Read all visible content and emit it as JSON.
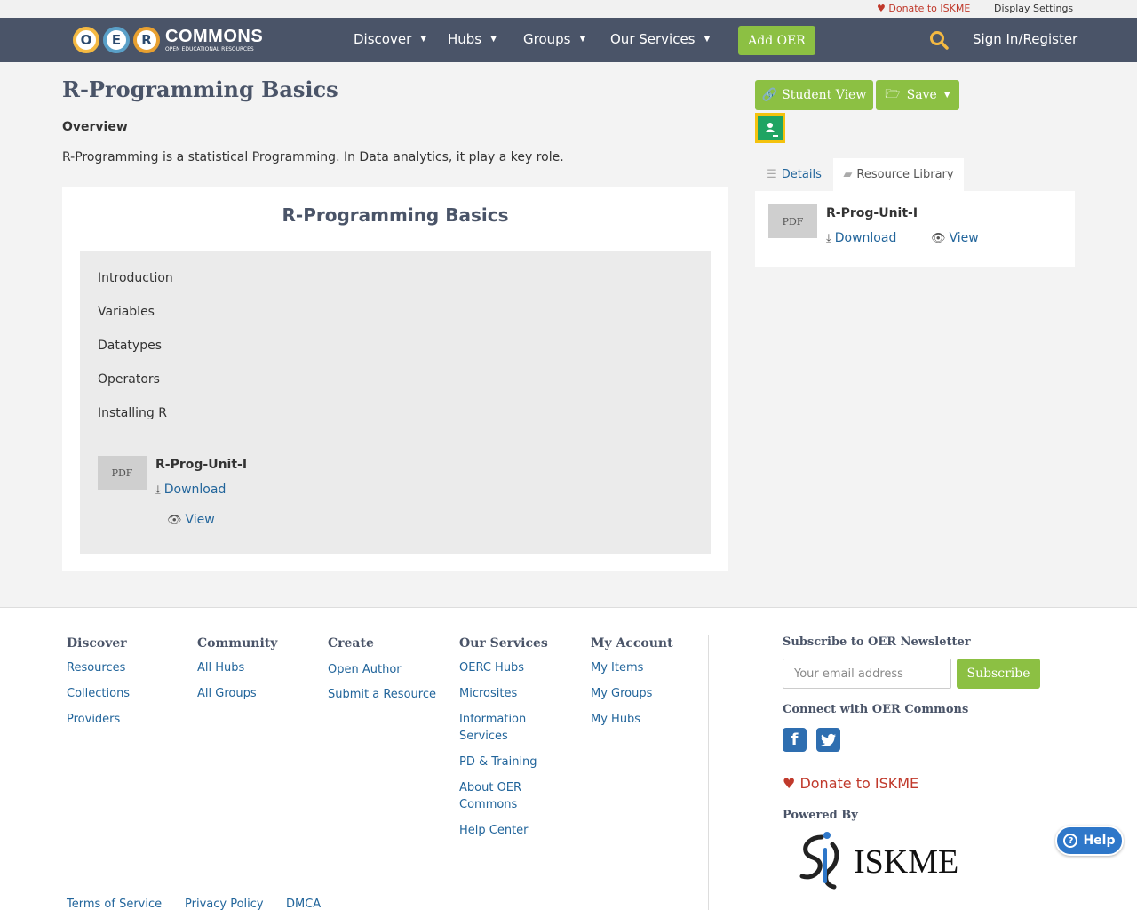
{
  "utility": {
    "donate": "Donate to ISKME",
    "display_settings": "Display Settings"
  },
  "nav": {
    "logo_letters": [
      "O",
      "E",
      "R"
    ],
    "logo_word": "COMMONS",
    "logo_tagline": "OPEN EDUCATIONAL RESOURCES",
    "items": [
      "Discover",
      "Hubs",
      "Groups",
      "Our Services"
    ],
    "add_oer": "Add OER",
    "sign_in": "Sign In/Register"
  },
  "page": {
    "title": "R-Programming Basics",
    "overview_label": "Overview",
    "overview_text": "R-Programming is a statistical Programming. In Data analytics, it play a key role."
  },
  "card": {
    "title": "R-Programming Basics",
    "topics": [
      "Introduction",
      "Variables",
      "Datatypes",
      "Operators",
      "Installing R"
    ],
    "file": {
      "type": "PDF",
      "name": "R-Prog-Unit-I",
      "download": "Download",
      "view": "View"
    }
  },
  "sidebar": {
    "student_view": "Student View",
    "save": "Save",
    "tabs": {
      "details": "Details",
      "library": "Resource Library"
    },
    "file": {
      "type": "PDF",
      "name": "R-Prog-Unit-I",
      "download": "Download",
      "view": "View"
    }
  },
  "footer": {
    "columns": [
      {
        "head": "Discover",
        "links": [
          "Resources",
          "Collections",
          "Providers"
        ]
      },
      {
        "head": "Community",
        "links": [
          "All Hubs",
          "All Groups"
        ]
      },
      {
        "head": "Create",
        "links": [
          "Open Author",
          "Submit a Resource"
        ]
      },
      {
        "head": "Our Services",
        "links": [
          "OERC Hubs",
          "Microsites",
          "Information Services",
          "PD & Training",
          "About OER Commons",
          "Help Center"
        ]
      },
      {
        "head": "My Account",
        "links": [
          "My Items",
          "My Groups",
          "My Hubs"
        ]
      }
    ],
    "newsletter_head": "Subscribe to OER Newsletter",
    "email_placeholder": "Your email address",
    "subscribe": "Subscribe",
    "connect_head": "Connect with OER Commons",
    "donate": "Donate to ISKME",
    "powered_by": "Powered By",
    "iskme": "ISKME",
    "bottom_links": [
      "Terms of Service",
      "Privacy Policy",
      "DMCA"
    ],
    "help": "Help"
  },
  "colors": {
    "nav": "#4a5468",
    "accent_green": "#8cc043",
    "link": "#22659b",
    "donate": "#c0392b"
  }
}
